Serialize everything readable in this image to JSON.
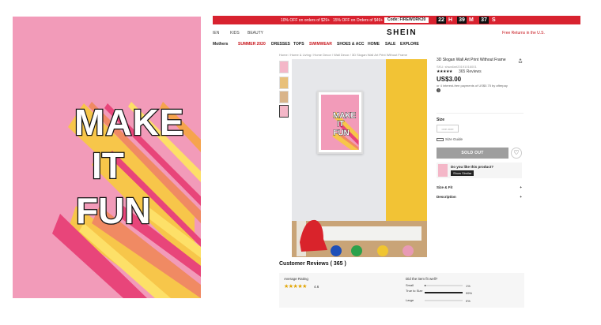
{
  "poster": {
    "line1": "MAKE",
    "line2": "IT",
    "line3": "FUN"
  },
  "colors": {
    "promo_red": "#d8222f",
    "poster_pink": "#f29bb9",
    "sold_out_gray": "#9e9e9e",
    "star_gold": "#e2a400",
    "free_returns_red": "#c7151b"
  },
  "promo": {
    "offer1": "10% OFF on orders of $29+",
    "offer2": "15% OFF on Orders of $49+",
    "code_label": "Code: FIREWORK20",
    "countdown": {
      "h": "22",
      "h_label": "H",
      "m": "39",
      "m_label": "M",
      "s": "37",
      "s_label": "S"
    }
  },
  "header": {
    "nav_women": "IEN",
    "nav_kids": "KIDS",
    "nav_beauty": "BEAUTY",
    "logo": "SHEIN",
    "free_returns": "Free Returns in the U.S."
  },
  "categories": [
    {
      "label": "Mothers",
      "highlight": false
    },
    {
      "label": "SUMMER 2020",
      "highlight": true
    },
    {
      "label": "DRESSES",
      "highlight": false
    },
    {
      "label": "TOPS",
      "highlight": false
    },
    {
      "label": "SWIMWEAR",
      "highlight": true
    },
    {
      "label": "SHOES & ACC",
      "highlight": false
    },
    {
      "label": "HOME",
      "highlight": false
    },
    {
      "label": "SALE",
      "highlight": false
    },
    {
      "label": "EXPLORE",
      "highlight": false
    }
  ],
  "breadcrumb": "Home / Home & Living / Home Decor / Wall Decor / 3D Slogan Wall Art Print Without Frame",
  "product": {
    "title": "3D Slogan Wall Art Print Without Frame",
    "sku": "SKU: shwallart20191016001",
    "stars": "★★★★★",
    "reviews": "365 Reviews",
    "price": "US$3.00",
    "afterpay": "or 4 interest-free payments of US$0.75 by afterpay",
    "help": "?",
    "size_label": "Size",
    "size_option": "one-size",
    "size_guide": "Size Guide",
    "sold_out": "SOLD OUT",
    "heart_icon": "heart-icon",
    "like_question": "Do you like this product?",
    "show_similar": "Show Similar",
    "size_fit": "Size & Fit",
    "description": "Description",
    "plus": "+"
  },
  "reviews": {
    "title": "Customer Reviews ( 365 )",
    "average_label": "Average Rating",
    "average_stars": "★★★★★",
    "average_value": "4.6",
    "fit_question": "Did the item fit well?",
    "fit": [
      {
        "label": "Small",
        "pct": "1%",
        "value": 0.01
      },
      {
        "label": "True to Size",
        "pct": "99%",
        "value": 0.99
      },
      {
        "label": "Large",
        "pct": "0%",
        "value": 0.0
      }
    ]
  }
}
